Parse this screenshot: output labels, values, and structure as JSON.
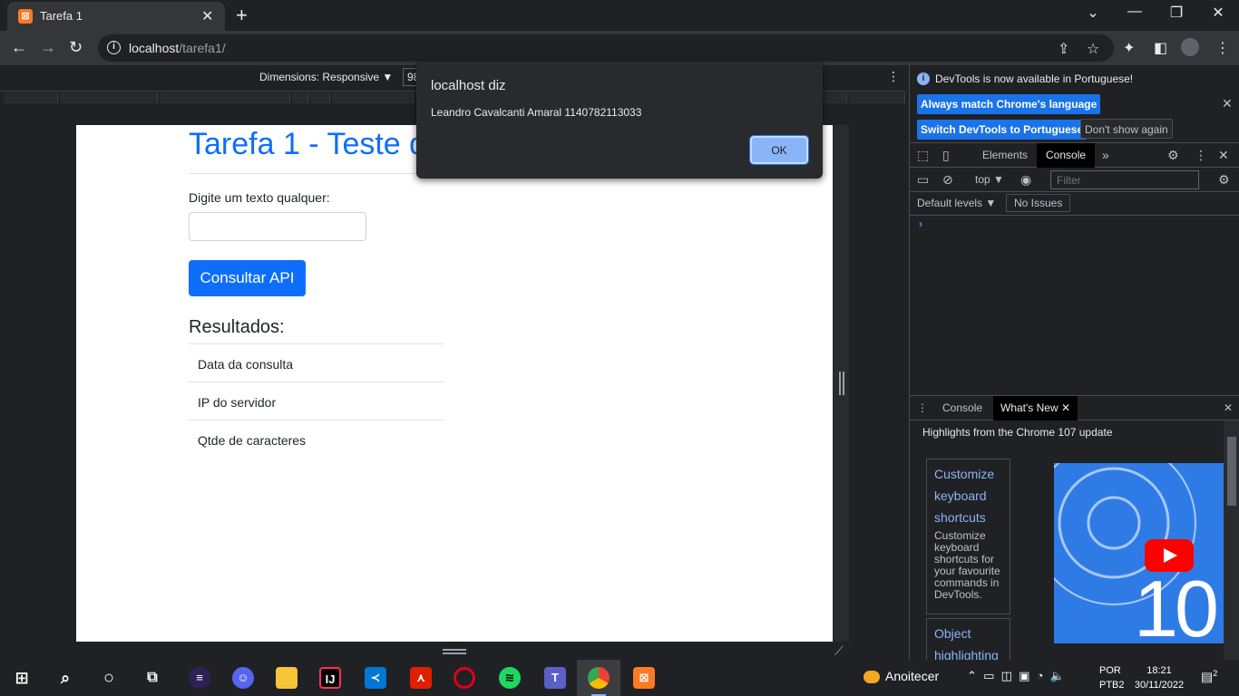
{
  "browser": {
    "tab_title": "Tarefa 1",
    "url_host": "localhost",
    "url_path": "/tarefa1/"
  },
  "devtoolbar": {
    "dimensions": "Dimensions: Responsive ▼",
    "width_value": "98"
  },
  "page": {
    "title": "Tarefa 1 - Teste d",
    "input_label": "Digite um texto qualquer:",
    "input_value": "",
    "button_label": "Consultar API",
    "results_heading": "Resultados:",
    "results": [
      "Data da consulta",
      "IP do servidor",
      "Qtde de caracteres"
    ]
  },
  "alert": {
    "origin": "localhost diz",
    "message": "Leandro Cavalcanti Amaral 1140782113033",
    "ok_label": "OK"
  },
  "devtools": {
    "info_text": "DevTools is now available in Portuguese!",
    "btn_match": "Always match Chrome's language",
    "btn_switch": "Switch DevTools to Portuguese",
    "btn_dont_show": "Don't show again",
    "tab_elements": "Elements",
    "tab_console": "Console",
    "context": "top ▼",
    "filter_placeholder": "Filter",
    "default_levels": "Default levels ▼",
    "no_issues": "No Issues",
    "prompt": "›",
    "drawer_console": "Console",
    "drawer_whatsnew": "What's New",
    "highlights": "Highlights from the Chrome 107 update",
    "card1_title": "Customize keyboard shortcuts",
    "card1_desc": "Customize keyboard shortcuts for your favourite commands in DevTools.",
    "card2_title": "Object highlighting",
    "video_number": "10"
  },
  "taskbar": {
    "weather": "Anoitecer",
    "lang_top": "POR",
    "lang_bottom": "PTB2",
    "time": "18:21",
    "date": "30/11/2022",
    "notifications": "2"
  },
  "colors": {
    "accent": "#0d6efd",
    "devtools_link": "#8ab4f8",
    "chrome_dark": "#202124"
  }
}
